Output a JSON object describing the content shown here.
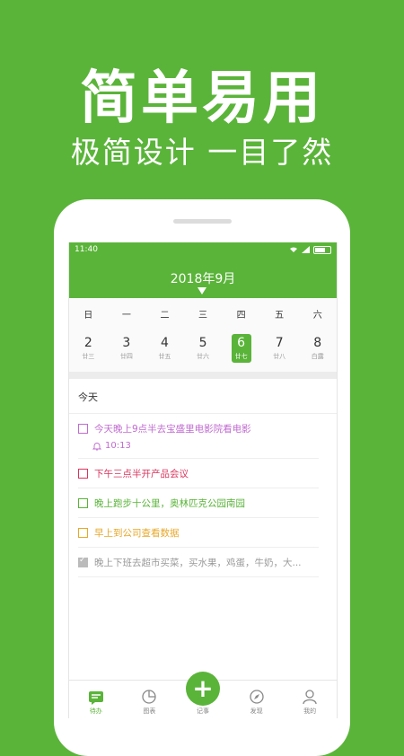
{
  "headline": "简单易用",
  "subline": "极简设计 一目了然",
  "colors": {
    "accent": "#5ab439"
  },
  "status": {
    "time": "11:40"
  },
  "calendar": {
    "month": "2018年9月",
    "weekdays": [
      "日",
      "一",
      "二",
      "三",
      "四",
      "五",
      "六"
    ],
    "days": [
      {
        "num": "2",
        "lunar": "廿三"
      },
      {
        "num": "3",
        "lunar": "廿四"
      },
      {
        "num": "4",
        "lunar": "廿五"
      },
      {
        "num": "5",
        "lunar": "廿六"
      },
      {
        "num": "6",
        "lunar": "廿七",
        "selected": true
      },
      {
        "num": "7",
        "lunar": "廿八"
      },
      {
        "num": "8",
        "lunar": "白露"
      }
    ]
  },
  "section_title": "今天",
  "tasks": [
    {
      "title": "今天晚上9点半去宝盛里电影院看电影",
      "color": "#c06bd0",
      "reminder": "10:13",
      "done": false
    },
    {
      "title": "下午三点半开产品会议",
      "color": "#d9345d",
      "done": false
    },
    {
      "title": "晚上跑步十公里，奥林匹克公园南园",
      "color": "#5ab439",
      "done": false
    },
    {
      "title": "早上到公司查看数据",
      "color": "#e7a82a",
      "done": false
    },
    {
      "title": "晚上下班去超市买菜，买水果，鸡蛋，牛奶，大...",
      "color": "#9a9a9a",
      "done": true
    }
  ],
  "tabs": [
    {
      "label": "待办",
      "icon": "todo-icon",
      "active": true
    },
    {
      "label": "图表",
      "icon": "chart-icon",
      "active": false
    },
    {
      "label": "记事",
      "icon": "add-icon",
      "active": false
    },
    {
      "label": "发现",
      "icon": "compass-icon",
      "active": false
    },
    {
      "label": "我的",
      "icon": "user-icon",
      "active": false
    }
  ]
}
